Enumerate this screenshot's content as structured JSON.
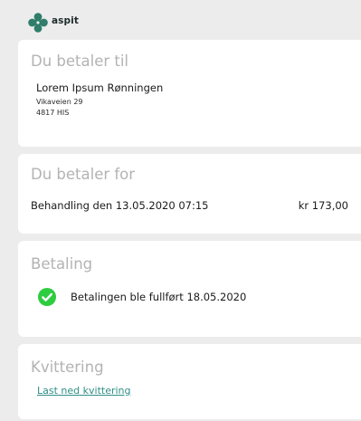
{
  "brand": {
    "name": "aspit",
    "logo_color": "#2f7d6a"
  },
  "payee": {
    "title": "Du betaler til",
    "name": "Lorem Ipsum Rønningen",
    "address_line1": "Vikaveien 29",
    "address_line2": "4817 HIS"
  },
  "payment_for": {
    "title": "Du betaler for",
    "item": "Behandling den 13.05.2020 07:15",
    "amount": "kr 173,00"
  },
  "payment": {
    "title": "Betaling",
    "status_icon": "check-circle-icon",
    "status_color": "#2ecc40",
    "status_text": "Betalingen ble fullført 18.05.2020"
  },
  "receipt": {
    "title": "Kvittering",
    "link_label": "Last ned kvittering",
    "link_color": "#2f8f87"
  }
}
